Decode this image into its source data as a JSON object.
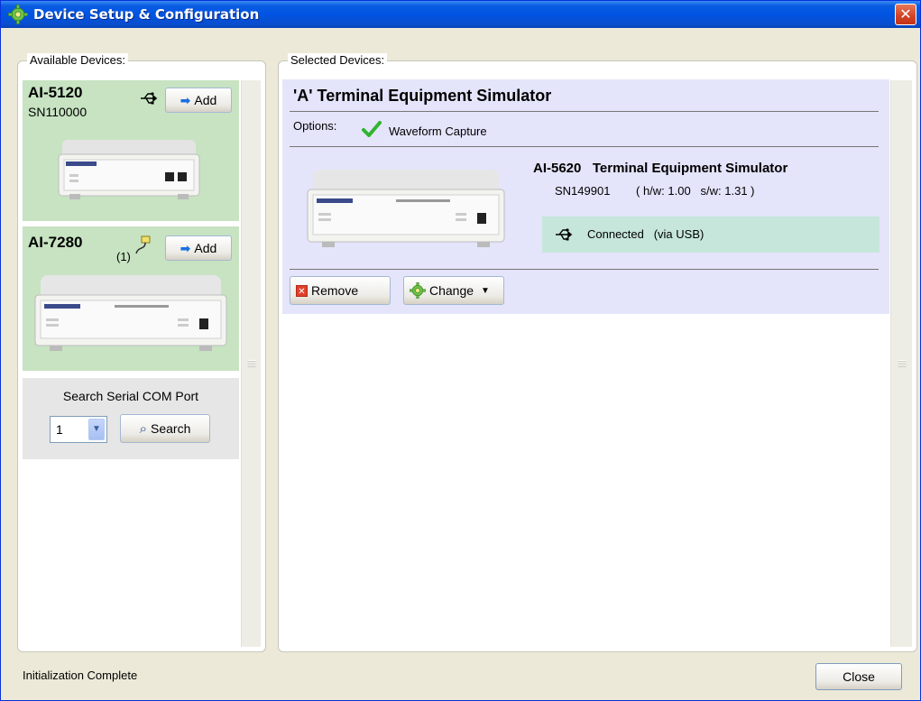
{
  "window": {
    "title": "Device Setup & Configuration",
    "close_glyph": "✕"
  },
  "available": {
    "legend": "Available Devices:",
    "devices": [
      {
        "name": "AI-5120",
        "serial": "SN110000",
        "add_label": "Add",
        "connection_icon": "usb-icon"
      },
      {
        "name": "AI-7280",
        "count_label": "(1)",
        "add_label": "Add",
        "connection_icon": "serial-cable-icon"
      }
    ],
    "search": {
      "title": "Search Serial COM Port",
      "port_value": "1",
      "button_label": "Search"
    }
  },
  "selected": {
    "legend": "Selected Devices:",
    "card": {
      "title": "'A'  Terminal Equipment Simulator",
      "options_label": "Options:",
      "option_value": "Waveform Capture",
      "model": "AI-5620   Terminal Equipment Simulator",
      "serial": "SN149901",
      "version": "( h/w: 1.00   s/w: 1.31 )",
      "connection": "Connected   (via USB)",
      "remove_label": "Remove",
      "change_label": "Change"
    }
  },
  "status": {
    "text": "Initialization Complete",
    "close_label": "Close"
  },
  "colors": {
    "available_card": "#c7e3c2",
    "selected_card": "#e4e4fb",
    "connection_box": "#c6e6dc",
    "titlebar": "#0054e3"
  }
}
